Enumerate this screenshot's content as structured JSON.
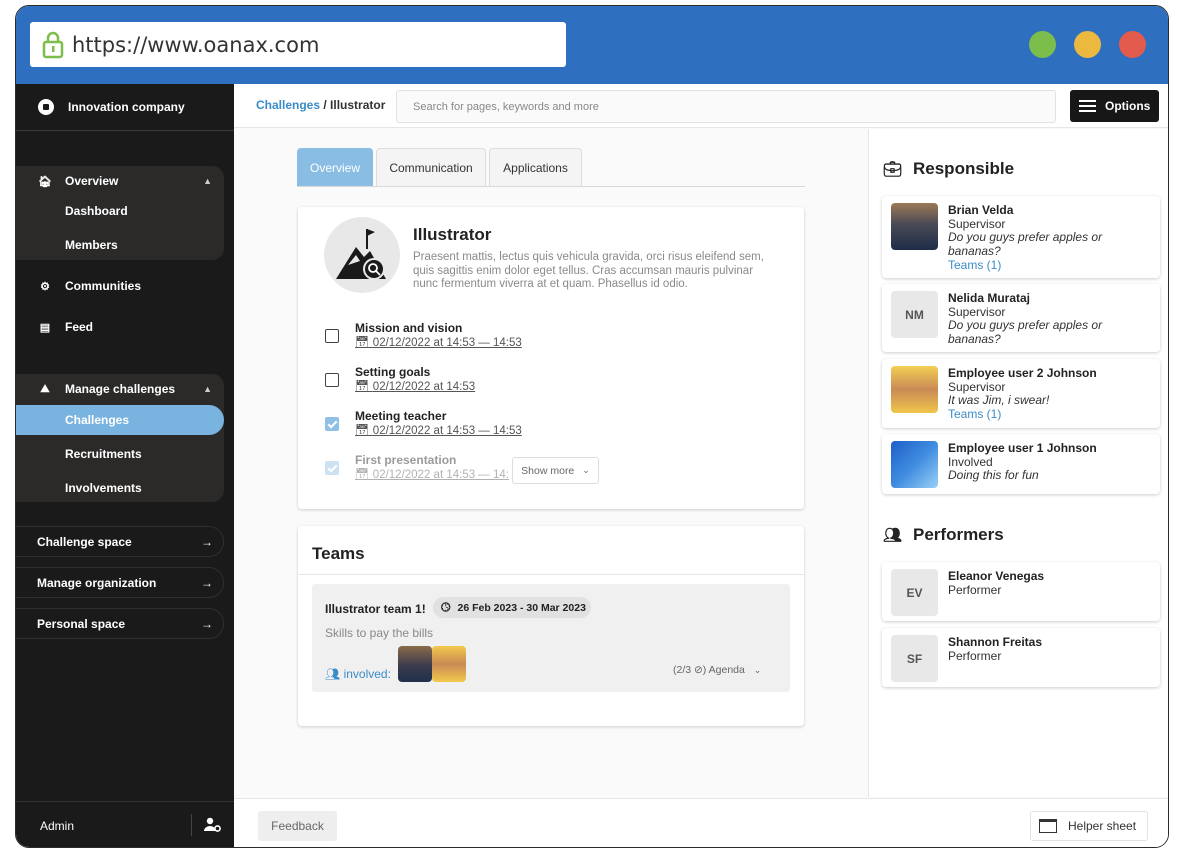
{
  "browser": {
    "url": "https://www.oanax.com",
    "dots": {
      "green": "#7cbd4b",
      "yellow": "#ebb940",
      "red": "#e25b4d"
    }
  },
  "sidebar": {
    "company": "Innovation company",
    "overview_group": {
      "label": "Overview",
      "items": [
        "Dashboard",
        "Members"
      ]
    },
    "communities": "Communities",
    "feed": "Feed",
    "manage_group": {
      "label": "Manage challenges",
      "items": [
        "Challenges",
        "Recruitments",
        "Involvements"
      ],
      "active": "Challenges"
    },
    "spaces": [
      "Challenge space",
      "Manage organization",
      "Personal space"
    ],
    "admin_label": "Admin"
  },
  "header": {
    "breadcrumb_link": "Challenges",
    "breadcrumb_sep": " / ",
    "breadcrumb_current": "Illustrator",
    "search_placeholder": "Search for pages, keywords and more",
    "options_label": "Options"
  },
  "tabs": [
    "Overview",
    "Communication",
    "Applications"
  ],
  "challenge": {
    "title": "Illustrator",
    "description": "Praesent mattis, lectus quis vehicula gravida, orci risus eleifend sem, quis sagittis enim dolor eget tellus. Cras accumsan mauris pulvinar nunc fermentum viverra at et quam. Phasellus id odio.",
    "tasks": [
      {
        "title": "Mission and vision",
        "date": "02/12/2022 at 14:53 — 14:53",
        "checked": false
      },
      {
        "title": "Setting goals",
        "date": "02/12/2022 at 14:53",
        "checked": false
      },
      {
        "title": "Meeting teacher",
        "date": "02/12/2022 at 14:53 — 14:53",
        "checked": true
      },
      {
        "title": "First presentation",
        "date": "02/12/2022 at 14:53 — 14:",
        "checked": true
      }
    ],
    "show_more": "Show more"
  },
  "teams": {
    "title": "Teams",
    "team": {
      "name": "Illustrator team 1!",
      "dates": "26 Feb 2023 - 30 Mar 2023",
      "skills": "Skills to pay the bills",
      "involved_label": "involved:",
      "agenda": "(2/3 ⊘) Agenda"
    }
  },
  "responsible": {
    "title": "Responsible",
    "people": [
      {
        "initials": "",
        "name": "Brian Velda",
        "role": "Supervisor",
        "quote": "Do you guys prefer apples or bananas?",
        "teams": "Teams (1)"
      },
      {
        "initials": "NM",
        "name": "Nelida Murataj",
        "role": "Supervisor",
        "quote": "Do you guys prefer apples or bananas?",
        "teams": ""
      },
      {
        "initials": "",
        "name": "Employee user 2 Johnson",
        "role": "Supervisor",
        "quote": "It was Jim, i swear!",
        "teams": "Teams (1)"
      },
      {
        "initials": "",
        "name": "Employee user 1 Johnson",
        "role": "Involved",
        "quote": "Doing this for fun",
        "teams": ""
      }
    ]
  },
  "performers": {
    "title": "Performers",
    "people": [
      {
        "initials": "EV",
        "name": "Eleanor Venegas",
        "role": "Performer"
      },
      {
        "initials": "SF",
        "name": "Shannon Freitas",
        "role": "Performer"
      }
    ]
  },
  "footer": {
    "feedback": "Feedback",
    "helper": "Helper sheet"
  }
}
